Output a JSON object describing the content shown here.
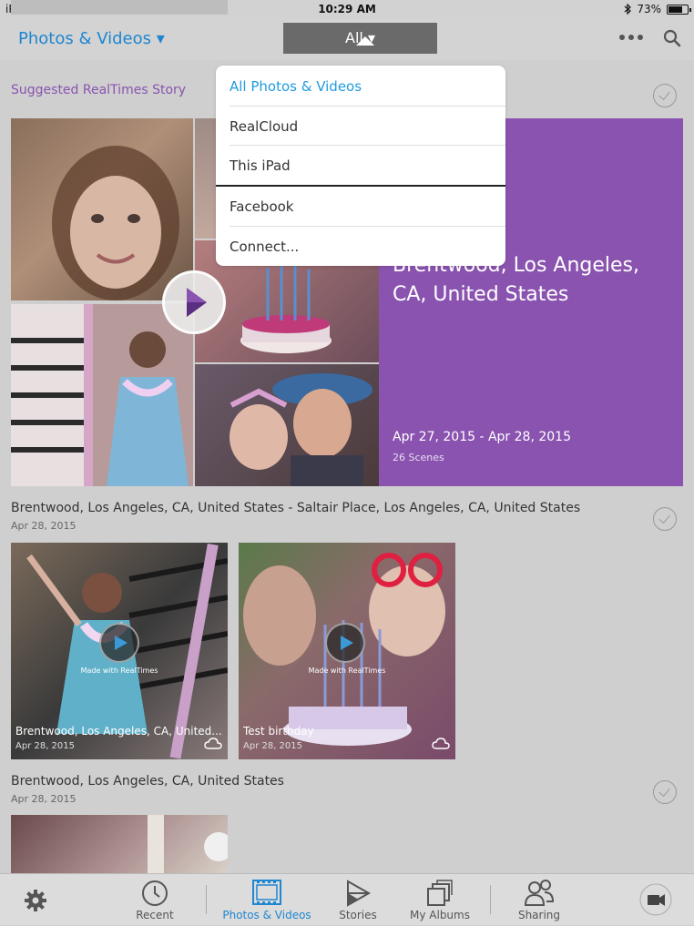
{
  "status_bar": {
    "device": "iPad",
    "time": "10:29 AM",
    "battery": "73%",
    "battery_level": 0.73
  },
  "nav": {
    "title": "Photos & Videos ▾",
    "filter_label": "All ▾"
  },
  "dropdown": {
    "items": [
      "All Photos & Videos",
      "RealCloud",
      "This iPad",
      "Facebook",
      "Connect..."
    ],
    "selected": "All Photos & Videos"
  },
  "suggested": {
    "heading": "Suggested RealTimes Story",
    "location": "Brentwood, Los Angeles, CA, United States",
    "date_range": "Apr 27, 2015 - Apr 28, 2015",
    "scenes": "26 Scenes"
  },
  "group1": {
    "title": "Brentwood, Los Angeles, CA, United States - Saltair Place, Los Angeles, CA, United States",
    "date": "Apr 28, 2015",
    "tiles": [
      {
        "badge": "Made with RealTimes",
        "title": "Brentwood, Los Angeles, CA, United...",
        "date": "Apr 28, 2015"
      },
      {
        "badge": "Made with RealTimes",
        "title": "Test birthday",
        "date": "Apr 28, 2015"
      }
    ]
  },
  "group2": {
    "title": "Brentwood, Los Angeles, CA, United States",
    "date": "Apr 28, 2015"
  },
  "tabs": {
    "recent": "Recent",
    "photos_videos": "Photos & Videos",
    "stories": "Stories",
    "my_albums": "My Albums",
    "sharing": "Sharing"
  },
  "colors": {
    "accent": "#1f86d0",
    "story_purple": "#8a53b0",
    "selected_blue": "#1e9be0"
  }
}
